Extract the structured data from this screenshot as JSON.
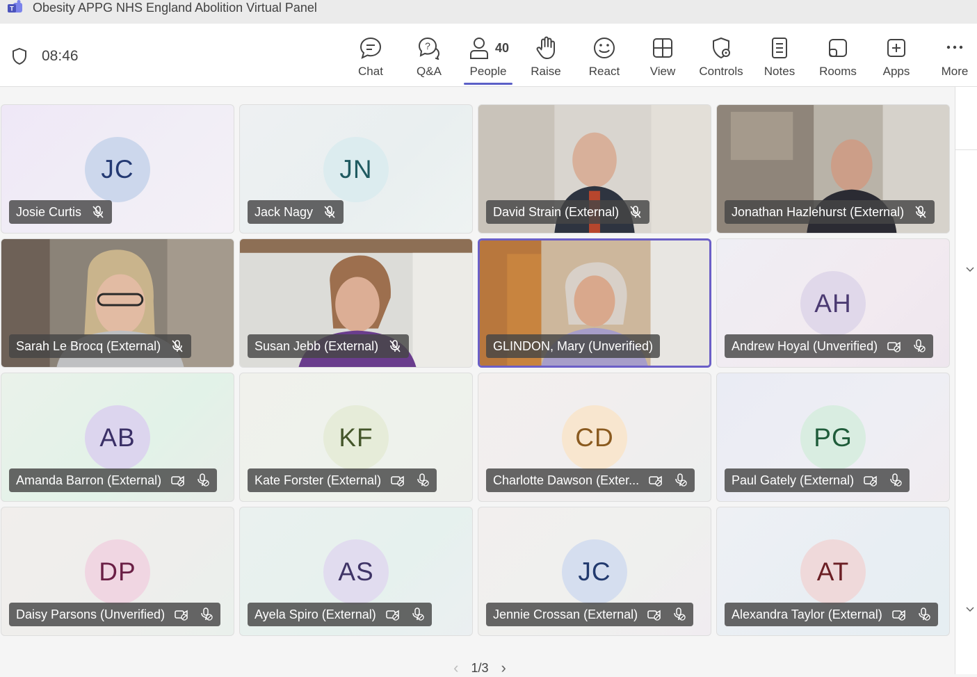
{
  "window": {
    "title": "Obesity APPG NHS England Abolition Virtual Panel"
  },
  "meeting": {
    "elapsed": "08:46"
  },
  "toolbar": {
    "buttons": [
      {
        "label": "Chat",
        "icon": "chat-icon"
      },
      {
        "label": "Q&A",
        "icon": "qa-icon"
      },
      {
        "label": "People",
        "icon": "people-icon",
        "count": "40",
        "active": true
      },
      {
        "label": "Raise",
        "icon": "raise-hand-icon"
      },
      {
        "label": "React",
        "icon": "smiley-icon"
      },
      {
        "label": "View",
        "icon": "grid-view-icon"
      },
      {
        "label": "Controls",
        "icon": "controls-icon"
      },
      {
        "label": "Notes",
        "icon": "notes-icon"
      },
      {
        "label": "Rooms",
        "icon": "rooms-icon"
      },
      {
        "label": "Apps",
        "icon": "add-apps-icon"
      },
      {
        "label": "More",
        "icon": "more-icon"
      }
    ]
  },
  "tiles": [
    {
      "name": "Josie Curtis",
      "initials": "JC",
      "type": "avatar",
      "mic_muted": true,
      "camera_off": false
    },
    {
      "name": "Jack Nagy",
      "initials": "JN",
      "type": "avatar",
      "mic_muted": true,
      "camera_off": false
    },
    {
      "name": "David Strain (External)",
      "initials": "",
      "type": "video",
      "mic_muted": true,
      "camera_off": false
    },
    {
      "name": "Jonathan Hazlehurst (External)",
      "initials": "",
      "type": "video",
      "mic_muted": true,
      "camera_off": false
    },
    {
      "name": "Sarah Le Brocq (External)",
      "initials": "",
      "type": "video",
      "mic_muted": true,
      "camera_off": false
    },
    {
      "name": "Susan Jebb (External)",
      "initials": "",
      "type": "video",
      "mic_muted": true,
      "camera_off": false
    },
    {
      "name": "GLINDON, Mary (Unverified)",
      "initials": "",
      "type": "video",
      "mic_muted": false,
      "camera_off": false,
      "speaking": true
    },
    {
      "name": "Andrew Hoyal (Unverified)",
      "initials": "AH",
      "type": "avatar",
      "mic_muted": true,
      "camera_off": true
    },
    {
      "name": "Amanda Barron (External)",
      "initials": "AB",
      "type": "avatar",
      "mic_muted": true,
      "camera_off": true
    },
    {
      "name": "Kate Forster (External)",
      "initials": "KF",
      "type": "avatar",
      "mic_muted": true,
      "camera_off": true
    },
    {
      "name": "Charlotte Dawson (Exter...",
      "initials": "CD",
      "type": "avatar",
      "mic_muted": true,
      "camera_off": true
    },
    {
      "name": "Paul Gately (External)",
      "initials": "PG",
      "type": "avatar",
      "mic_muted": true,
      "camera_off": true
    },
    {
      "name": "Daisy Parsons (Unverified)",
      "initials": "DP",
      "type": "avatar",
      "mic_muted": true,
      "camera_off": true
    },
    {
      "name": "Ayela Spiro (External)",
      "initials": "AS",
      "type": "avatar",
      "mic_muted": true,
      "camera_off": true
    },
    {
      "name": "Jennie Crossan (External)",
      "initials": "JC",
      "type": "avatar",
      "mic_muted": true,
      "camera_off": true
    },
    {
      "name": "Alexandra Taylor (External)",
      "initials": "AT",
      "type": "avatar",
      "mic_muted": true,
      "camera_off": true
    }
  ],
  "pager": {
    "current": "1/3"
  },
  "colors": {
    "accent": "#5b5fc7"
  }
}
